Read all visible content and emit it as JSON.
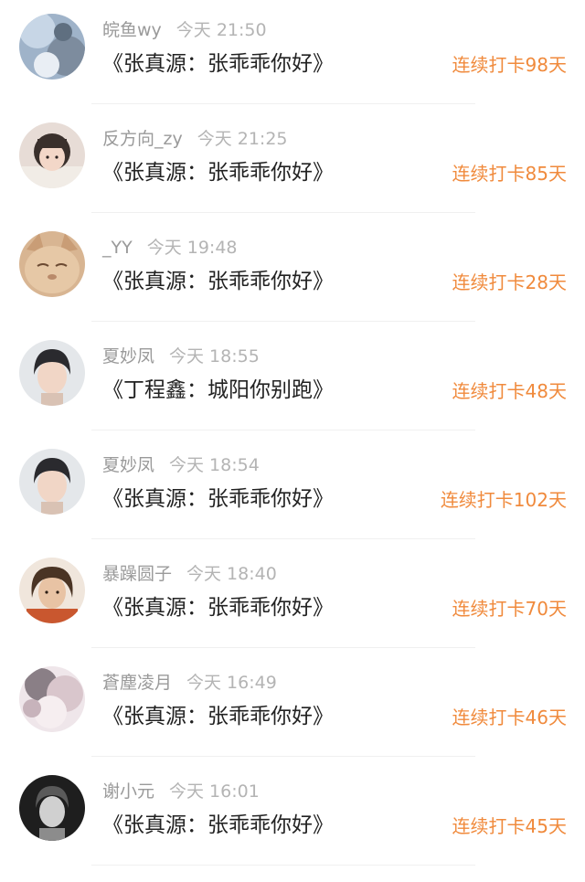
{
  "checkins": [
    {
      "user": "皖鱼wy",
      "time": "今天 21:50",
      "title": "《张真源：张乖乖你好》",
      "streak": "连续打卡98天",
      "avatar": "blurred-photo-avatar"
    },
    {
      "user": "反方向_zy",
      "time": "今天 21:25",
      "title": "《张真源：张乖乖你好》",
      "streak": "连续打卡85天",
      "avatar": "girl-photo-avatar"
    },
    {
      "user": "_YY",
      "time": "今天 19:48",
      "title": "《张真源：张乖乖你好》",
      "streak": "连续打卡28天",
      "avatar": "cat-avatar"
    },
    {
      "user": "夏妙凤",
      "time": "今天 18:55",
      "title": "《丁程鑫：城阳你别跑》",
      "streak": "连续打卡48天",
      "avatar": "boy-portrait-avatar"
    },
    {
      "user": "夏妙凤",
      "time": "今天 18:54",
      "title": "《张真源：张乖乖你好》",
      "streak": "连续打卡102天",
      "avatar": "boy-portrait-avatar"
    },
    {
      "user": "暴躁圆子",
      "time": "今天 18:40",
      "title": "《张真源：张乖乖你好》",
      "streak": "连续打卡70天",
      "avatar": "anime-character-avatar"
    },
    {
      "user": "蒼塵凌月",
      "time": "今天 16:49",
      "title": "《张真源：张乖乖你好》",
      "streak": "连续打卡46天",
      "avatar": "blurred-face-avatar"
    },
    {
      "user": "谢小元",
      "time": "今天 16:01",
      "title": "《张真源：张乖乖你好》",
      "streak": "连续打卡45天",
      "avatar": "monochrome-photo-avatar"
    }
  ],
  "colors": {
    "streak": "#f08a3c",
    "username": "#9a9a9a",
    "time": "#b4b4b4",
    "title": "#222222",
    "divider": "#f0f0f0",
    "background": "#ffffff"
  }
}
